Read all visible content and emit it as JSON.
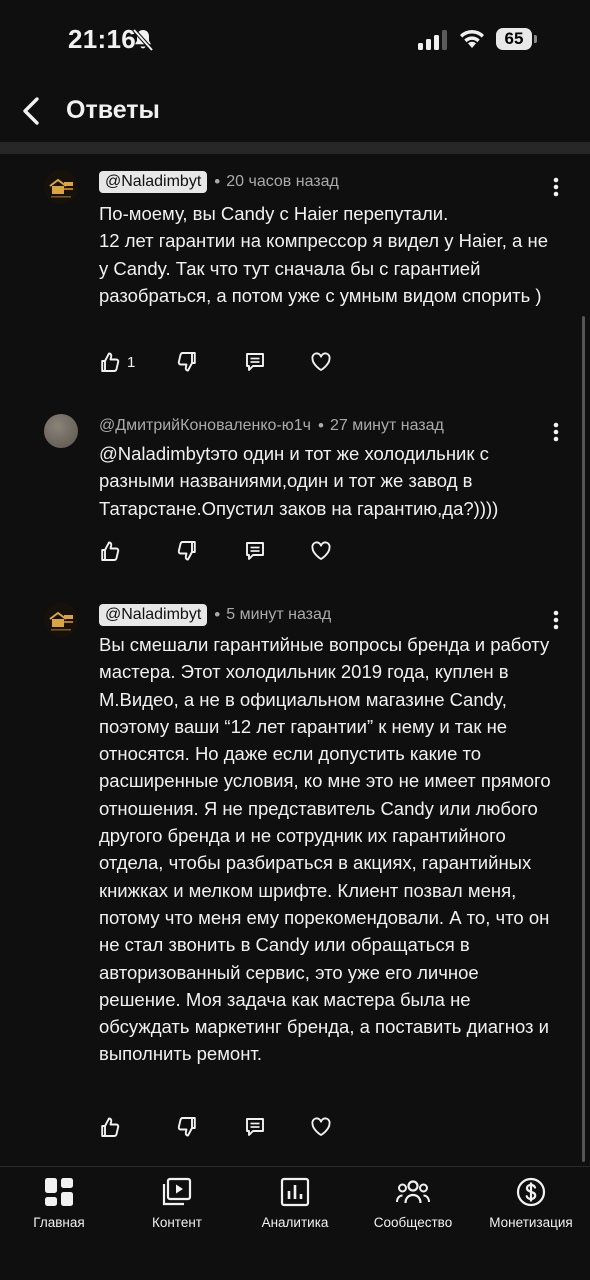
{
  "status_bar": {
    "time": "21:16",
    "battery": "65",
    "icons": [
      "bell-off-icon",
      "cellular-signal-icon",
      "wifi-icon",
      "battery-icon"
    ]
  },
  "header": {
    "title": "Ответы",
    "back_icon": "chevron-left-icon"
  },
  "comments": [
    {
      "author": "@Naladimbyt",
      "time": "20 часов назад",
      "text": "По-моему, вы Candy с Haier перепутали.\n12 лет гарантии на компрессор я видел у Haier, а не у Candy. Так что тут сначала бы с гарантией разобраться, а потом уже с умным видом спорить )",
      "likes": "1"
    },
    {
      "author": "@ДмитрийКоноваленко-ю1ч",
      "time": "27 минут назад",
      "text": "@Naladimbytэто один и тот же холодильник с разными названиями,один и тот же завод в Татарстане.Опустил заков на гарантию,да?))))",
      "likes": ""
    },
    {
      "author": "@Naladimbyt",
      "time": "5 минут назад",
      "text": "Вы смешали гарантийные вопросы бренда и работу мастера. Этот холодильник 2019 года, куплен в М.Видео, а не в официальном магазине Candy, поэтому ваши “12 лет гарантии” к нему и так не относятся. Но даже если допустить какие то расширенные условия, ко мне это не имеет прямого отношения. Я не представитель Candy или любого другого бренда и не сотрудник их гарантийного отдела, чтобы разбираться в акциях, гарантийных книжках и мелком шрифте. Клиент позвал меня, потому что меня ему порекомендовали. А то, что он не стал звонить в Candy или обращаться в авторизованный сервис, это уже его личное решение. Моя задача как мастера была не обсуждать маркетинг бренда, а поставить диагноз и выполнить ремонт.",
      "likes": ""
    }
  ],
  "action_icons": [
    "thumb-up-icon",
    "thumb-down-icon",
    "reply-icon",
    "heart-icon"
  ],
  "bottom_nav": [
    {
      "label": "Главная",
      "icon": "home-grid-icon"
    },
    {
      "label": "Контент",
      "icon": "content-play-icon"
    },
    {
      "label": "Аналитика",
      "icon": "analytics-chart-icon"
    },
    {
      "label": "Сообщество",
      "icon": "community-people-icon"
    },
    {
      "label": "Монетизация",
      "icon": "dollar-coin-icon"
    }
  ]
}
